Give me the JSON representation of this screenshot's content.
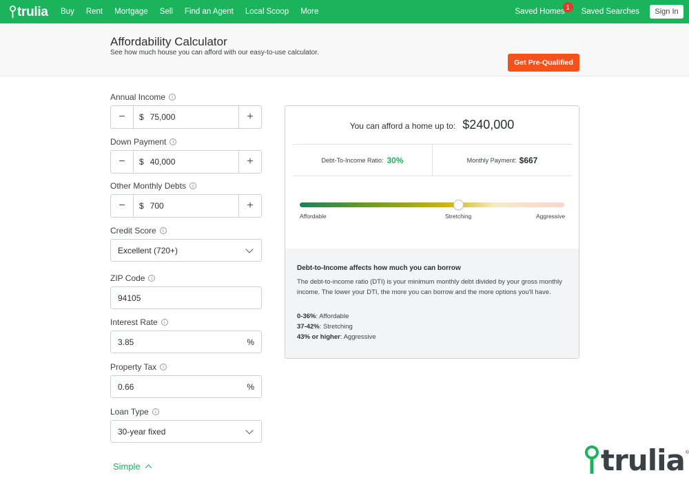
{
  "nav": {
    "logo": "trulia",
    "links": [
      "Buy",
      "Rent",
      "Mortgage",
      "Sell",
      "Find an Agent",
      "Local Scoop",
      "More"
    ],
    "saved_homes": "Saved Homes",
    "saved_homes_count": "1",
    "saved_searches": "Saved Searches",
    "sign_in": "Sign In"
  },
  "header": {
    "title": "Affordability Calculator",
    "subtitle": "See how much house you can afford with our easy-to-use calculator.",
    "cta": "Get Pre-Qualified"
  },
  "form": {
    "annual_income": {
      "label": "Annual Income",
      "currency": "$",
      "value": "75,000"
    },
    "down_payment": {
      "label": "Down Payment",
      "currency": "$",
      "value": "40,000"
    },
    "monthly_debts": {
      "label": "Other Monthly Debts",
      "currency": "$",
      "value": "700"
    },
    "credit_score": {
      "label": "Credit Score",
      "value": "Excellent (720+)"
    },
    "zip": {
      "label": "ZIP Code",
      "value": "94105"
    },
    "interest_rate": {
      "label": "Interest Rate",
      "value": "3.85",
      "unit": "%"
    },
    "property_tax": {
      "label": "Property Tax",
      "value": "0.66",
      "unit": "%"
    },
    "loan_type": {
      "label": "Loan Type",
      "value": "30-year fixed"
    },
    "minus": "−",
    "plus": "+",
    "info": "i",
    "toggle": "Simple"
  },
  "result": {
    "afford_label": "You can afford a home up to:",
    "afford_value": "$240,000",
    "dti_label": "Debt-To-Income Ratio:",
    "dti_value": "30%",
    "monthly_label": "Monthly Payment:",
    "monthly_value": "$667",
    "slider_position": 0.6,
    "slider_labels": [
      "Affordable",
      "Stretching",
      "Aggressive"
    ],
    "colors": {
      "affordable": "#1f7e5d",
      "stretching": "#d0b316",
      "aggressive": "#f9d6cc"
    },
    "info_heading": "Debt-to-Income affects how much you can borrow",
    "info_body": "The debt-to-income ratio (DTI) is your minimum monthly debt divided by your gross monthly income. The lower your DTI, the more you can borrow and the more options you'll have.",
    "ranges": [
      {
        "range": "0-36%",
        "label": ": Affordable"
      },
      {
        "range": "37-42%",
        "label": ": Stretching"
      },
      {
        "range": "43% or higher",
        "label": ": Aggressive"
      }
    ]
  },
  "brand": {
    "logo": "trulia",
    "tm": "®",
    "accent": "#1bb35c",
    "cta_color": "#f5511d"
  }
}
